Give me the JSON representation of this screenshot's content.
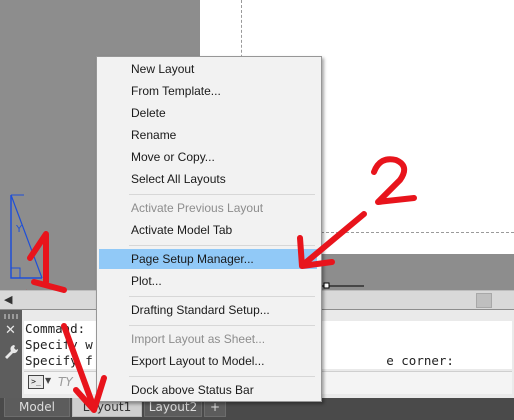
{
  "menu": {
    "items": [
      {
        "label": "New Layout",
        "enabled": true
      },
      {
        "label": "From Template...",
        "enabled": true
      },
      {
        "label": "Delete",
        "enabled": true
      },
      {
        "label": "Rename",
        "enabled": true
      },
      {
        "label": "Move or Copy...",
        "enabled": true
      },
      {
        "label": "Select All Layouts",
        "enabled": true
      },
      {
        "label": "Activate Previous Layout",
        "enabled": false
      },
      {
        "label": "Activate Model Tab",
        "enabled": true
      },
      {
        "label": "Page Setup Manager...",
        "enabled": true,
        "highlighted": true
      },
      {
        "label": "Plot...",
        "enabled": true
      },
      {
        "label": "Drafting Standard Setup...",
        "enabled": true
      },
      {
        "label": "Import Layout as Sheet...",
        "enabled": false
      },
      {
        "label": "Export Layout to Model...",
        "enabled": true
      },
      {
        "label": "Dock above Status Bar",
        "enabled": true
      }
    ]
  },
  "command_window": {
    "lines": [
      "Command:",
      "Specify w",
      "Specify f                                       e corner:"
    ],
    "prompt_icon": ">_",
    "input_placeholder": "TY"
  },
  "tabs": {
    "model": "Model",
    "layout1": "Layout1",
    "layout2": "Layout2",
    "add": "+"
  },
  "annotations": {
    "numbers": [
      "1",
      "2"
    ],
    "color": "#e8141c"
  },
  "colors": {
    "menu_highlight": "#91c9f7",
    "canvas_bg": "#8d8d8d",
    "tab_bar": "#4a4a4a"
  },
  "icons": [
    "close-icon",
    "wrench-icon",
    "command-prompt-icon",
    "ucs-icon",
    "scroll-left-icon"
  ]
}
